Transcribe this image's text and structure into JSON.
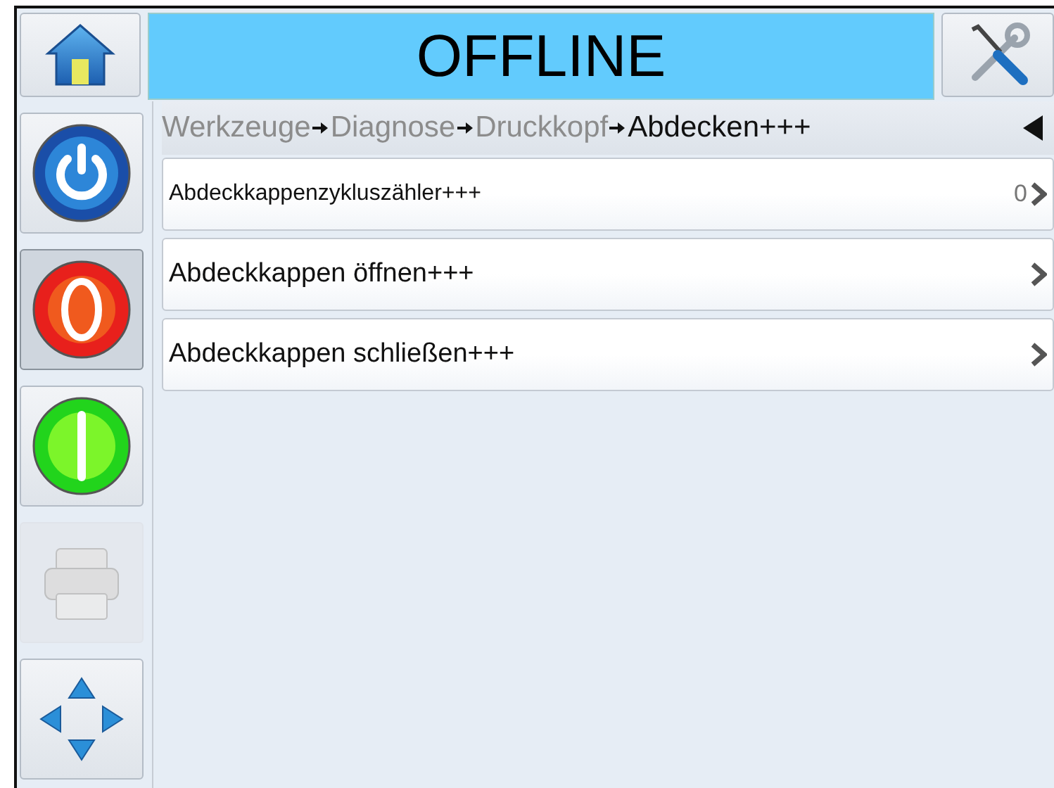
{
  "status": {
    "text": "OFFLINE"
  },
  "sidebar": {
    "items": [
      {
        "kind": "power",
        "selected": false,
        "disabled": false
      },
      {
        "kind": "stop",
        "selected": true,
        "disabled": false
      },
      {
        "kind": "start",
        "selected": false,
        "disabled": false
      },
      {
        "kind": "print",
        "selected": false,
        "disabled": true
      },
      {
        "kind": "navigate",
        "selected": false,
        "disabled": false
      }
    ]
  },
  "breadcrumb": {
    "items": [
      {
        "label": "Werkzeuge",
        "current": false
      },
      {
        "label": "Diagnose",
        "current": false
      },
      {
        "label": "Druckkopf",
        "current": false
      },
      {
        "label": "Abdecken+++",
        "current": true
      }
    ]
  },
  "menu": {
    "items": [
      {
        "kind": "counter",
        "label": "Abdeckkappenzykluszähler+++",
        "value": "0"
      },
      {
        "kind": "action",
        "label": "Abdeckkappen öffnen+++"
      },
      {
        "kind": "action",
        "label": "Abdeckkappen schließen+++"
      }
    ]
  }
}
